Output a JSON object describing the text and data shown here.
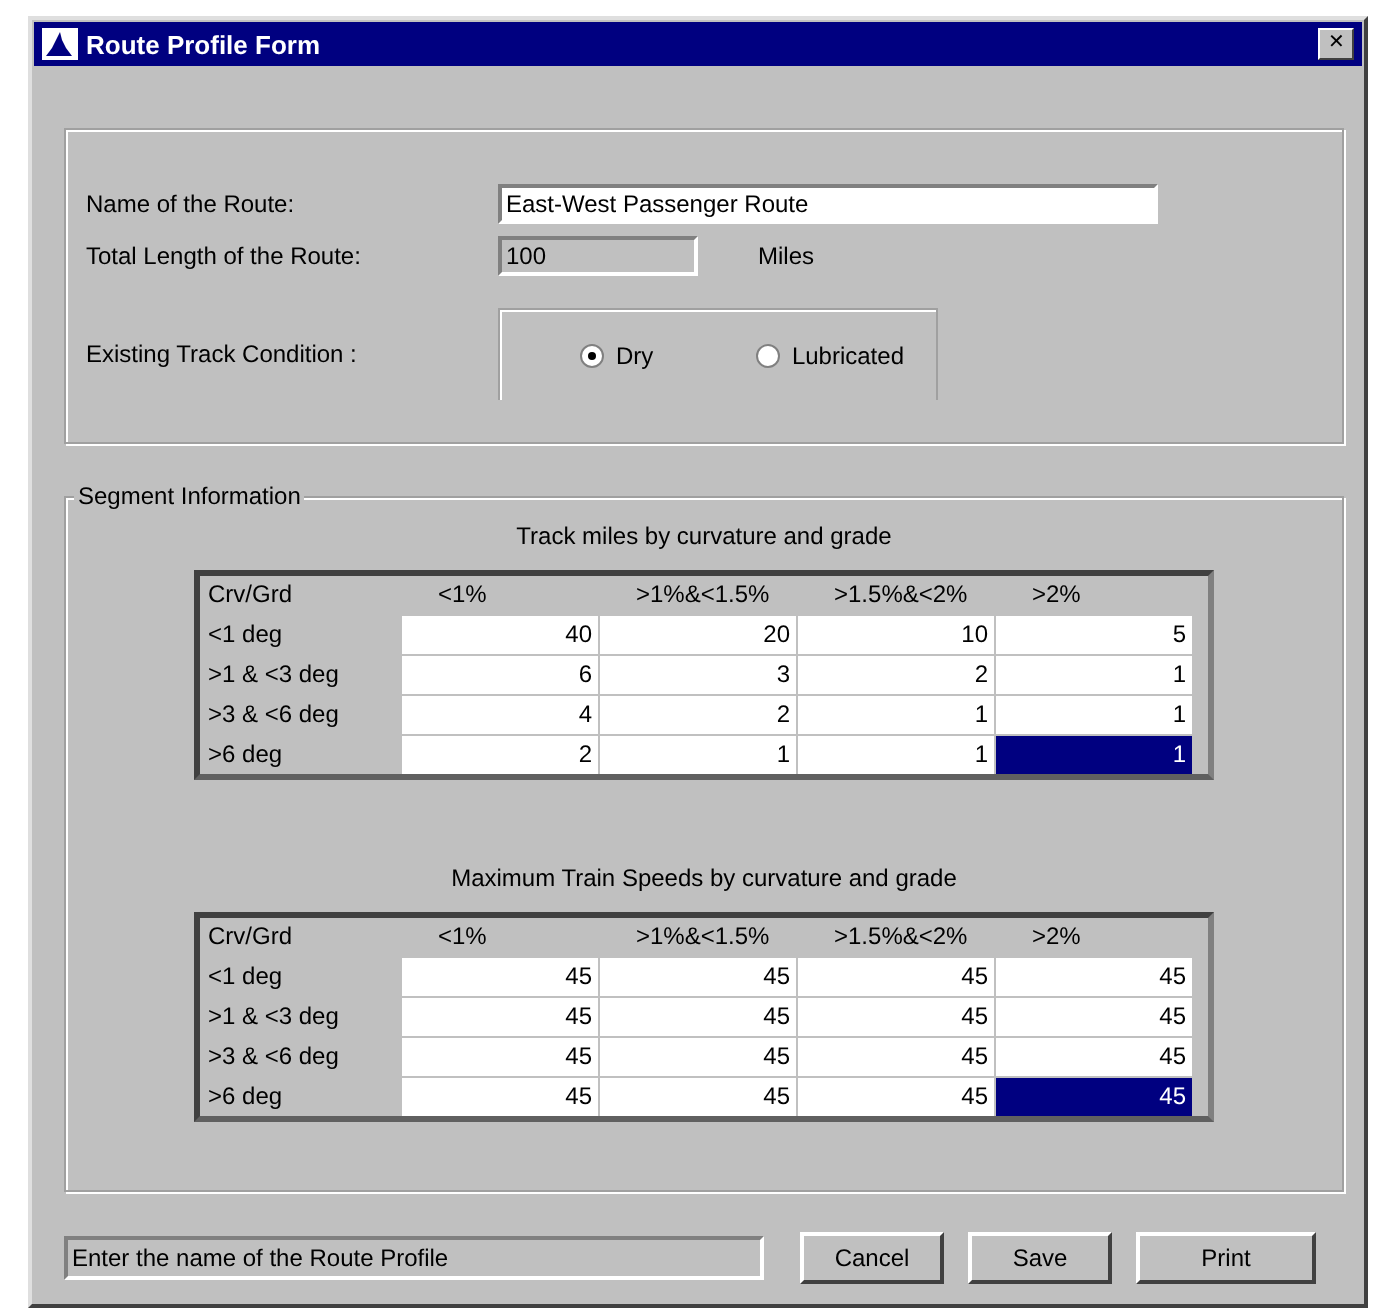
{
  "window": {
    "title": "Route Profile Form",
    "close": "✕"
  },
  "route": {
    "name_label": "Name of the Route:",
    "name_value": "East-West Passenger Route",
    "length_label": "Total Length of the Route:",
    "length_value": "100",
    "length_unit": "Miles",
    "condition_label": "Existing Track Condition :",
    "conditions": [
      {
        "label": "Dry",
        "selected": true
      },
      {
        "label": "Lubricated",
        "selected": false
      }
    ]
  },
  "segment": {
    "title": "Segment Information",
    "tables": [
      {
        "caption": "Track miles by curvature and grade",
        "columns": [
          "Crv/Grd",
          "<1%",
          ">1%&<1.5%",
          ">1.5%&<2%",
          ">2%"
        ],
        "rows": [
          {
            "label": "<1 deg",
            "cells": [
              {
                "value": "40",
                "selected": false
              },
              {
                "value": "20",
                "selected": false
              },
              {
                "value": "10",
                "selected": false
              },
              {
                "value": "5",
                "selected": false
              }
            ]
          },
          {
            "label": ">1 & <3 deg",
            "cells": [
              {
                "value": "6",
                "selected": false
              },
              {
                "value": "3",
                "selected": false
              },
              {
                "value": "2",
                "selected": false
              },
              {
                "value": "1",
                "selected": false
              }
            ]
          },
          {
            "label": ">3 & <6 deg",
            "cells": [
              {
                "value": "4",
                "selected": false
              },
              {
                "value": "2",
                "selected": false
              },
              {
                "value": "1",
                "selected": false
              },
              {
                "value": "1",
                "selected": false
              }
            ]
          },
          {
            "label": ">6 deg",
            "cells": [
              {
                "value": "2",
                "selected": false
              },
              {
                "value": "1",
                "selected": false
              },
              {
                "value": "1",
                "selected": false
              },
              {
                "value": "1",
                "selected": true
              }
            ]
          }
        ]
      },
      {
        "caption": "Maximum Train Speeds by curvature and grade",
        "columns": [
          "Crv/Grd",
          "<1%",
          ">1%&<1.5%",
          ">1.5%&<2%",
          ">2%"
        ],
        "rows": [
          {
            "label": "<1 deg",
            "cells": [
              {
                "value": "45",
                "selected": false
              },
              {
                "value": "45",
                "selected": false
              },
              {
                "value": "45",
                "selected": false
              },
              {
                "value": "45",
                "selected": false
              }
            ]
          },
          {
            "label": ">1 & <3 deg",
            "cells": [
              {
                "value": "45",
                "selected": false
              },
              {
                "value": "45",
                "selected": false
              },
              {
                "value": "45",
                "selected": false
              },
              {
                "value": "45",
                "selected": false
              }
            ]
          },
          {
            "label": ">3 & <6 deg",
            "cells": [
              {
                "value": "45",
                "selected": false
              },
              {
                "value": "45",
                "selected": false
              },
              {
                "value": "45",
                "selected": false
              },
              {
                "value": "45",
                "selected": false
              }
            ]
          },
          {
            "label": ">6 deg",
            "cells": [
              {
                "value": "45",
                "selected": false
              },
              {
                "value": "45",
                "selected": false
              },
              {
                "value": "45",
                "selected": false
              },
              {
                "value": "45",
                "selected": true
              }
            ]
          }
        ]
      }
    ]
  },
  "status_bar": {
    "text": "Enter the name of the Route Profile"
  },
  "buttons": [
    "Cancel",
    "Save",
    "Print"
  ]
}
